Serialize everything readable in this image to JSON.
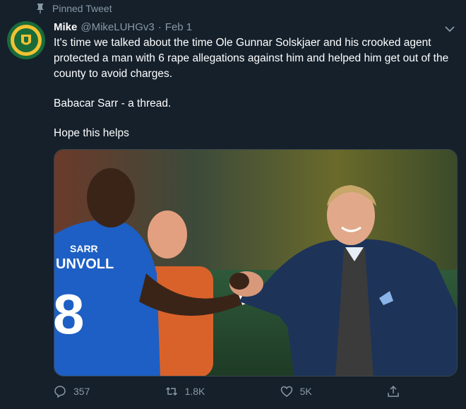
{
  "pinned_label": "Pinned Tweet",
  "tweet": {
    "author_name": "Mike",
    "author_handle": "@MikeLUHGv3",
    "separator": "·",
    "date": "Feb 1",
    "paragraphs": [
      "It's time we talked about the time Ole Gunnar Solskjaer and his crooked agent protected a man with 6 rape allegations against him and helped him get out of the county to avoid charges.",
      "Babacar Sarr - a thread.",
      "Hope this helps"
    ],
    "image": {
      "jersey_name": "SARR",
      "jersey_team": "UNVOLL",
      "jersey_number": "8"
    },
    "actions": {
      "replies": "357",
      "retweets": "1.8K",
      "likes": "5K"
    }
  },
  "colors": {
    "background": "#15202b",
    "muted": "#8899a6",
    "text": "#ffffff"
  },
  "icons": {
    "pin": "pin-icon",
    "caret": "chevron-down-icon",
    "reply": "reply-icon",
    "retweet": "retweet-icon",
    "like": "heart-icon",
    "share": "share-icon"
  }
}
